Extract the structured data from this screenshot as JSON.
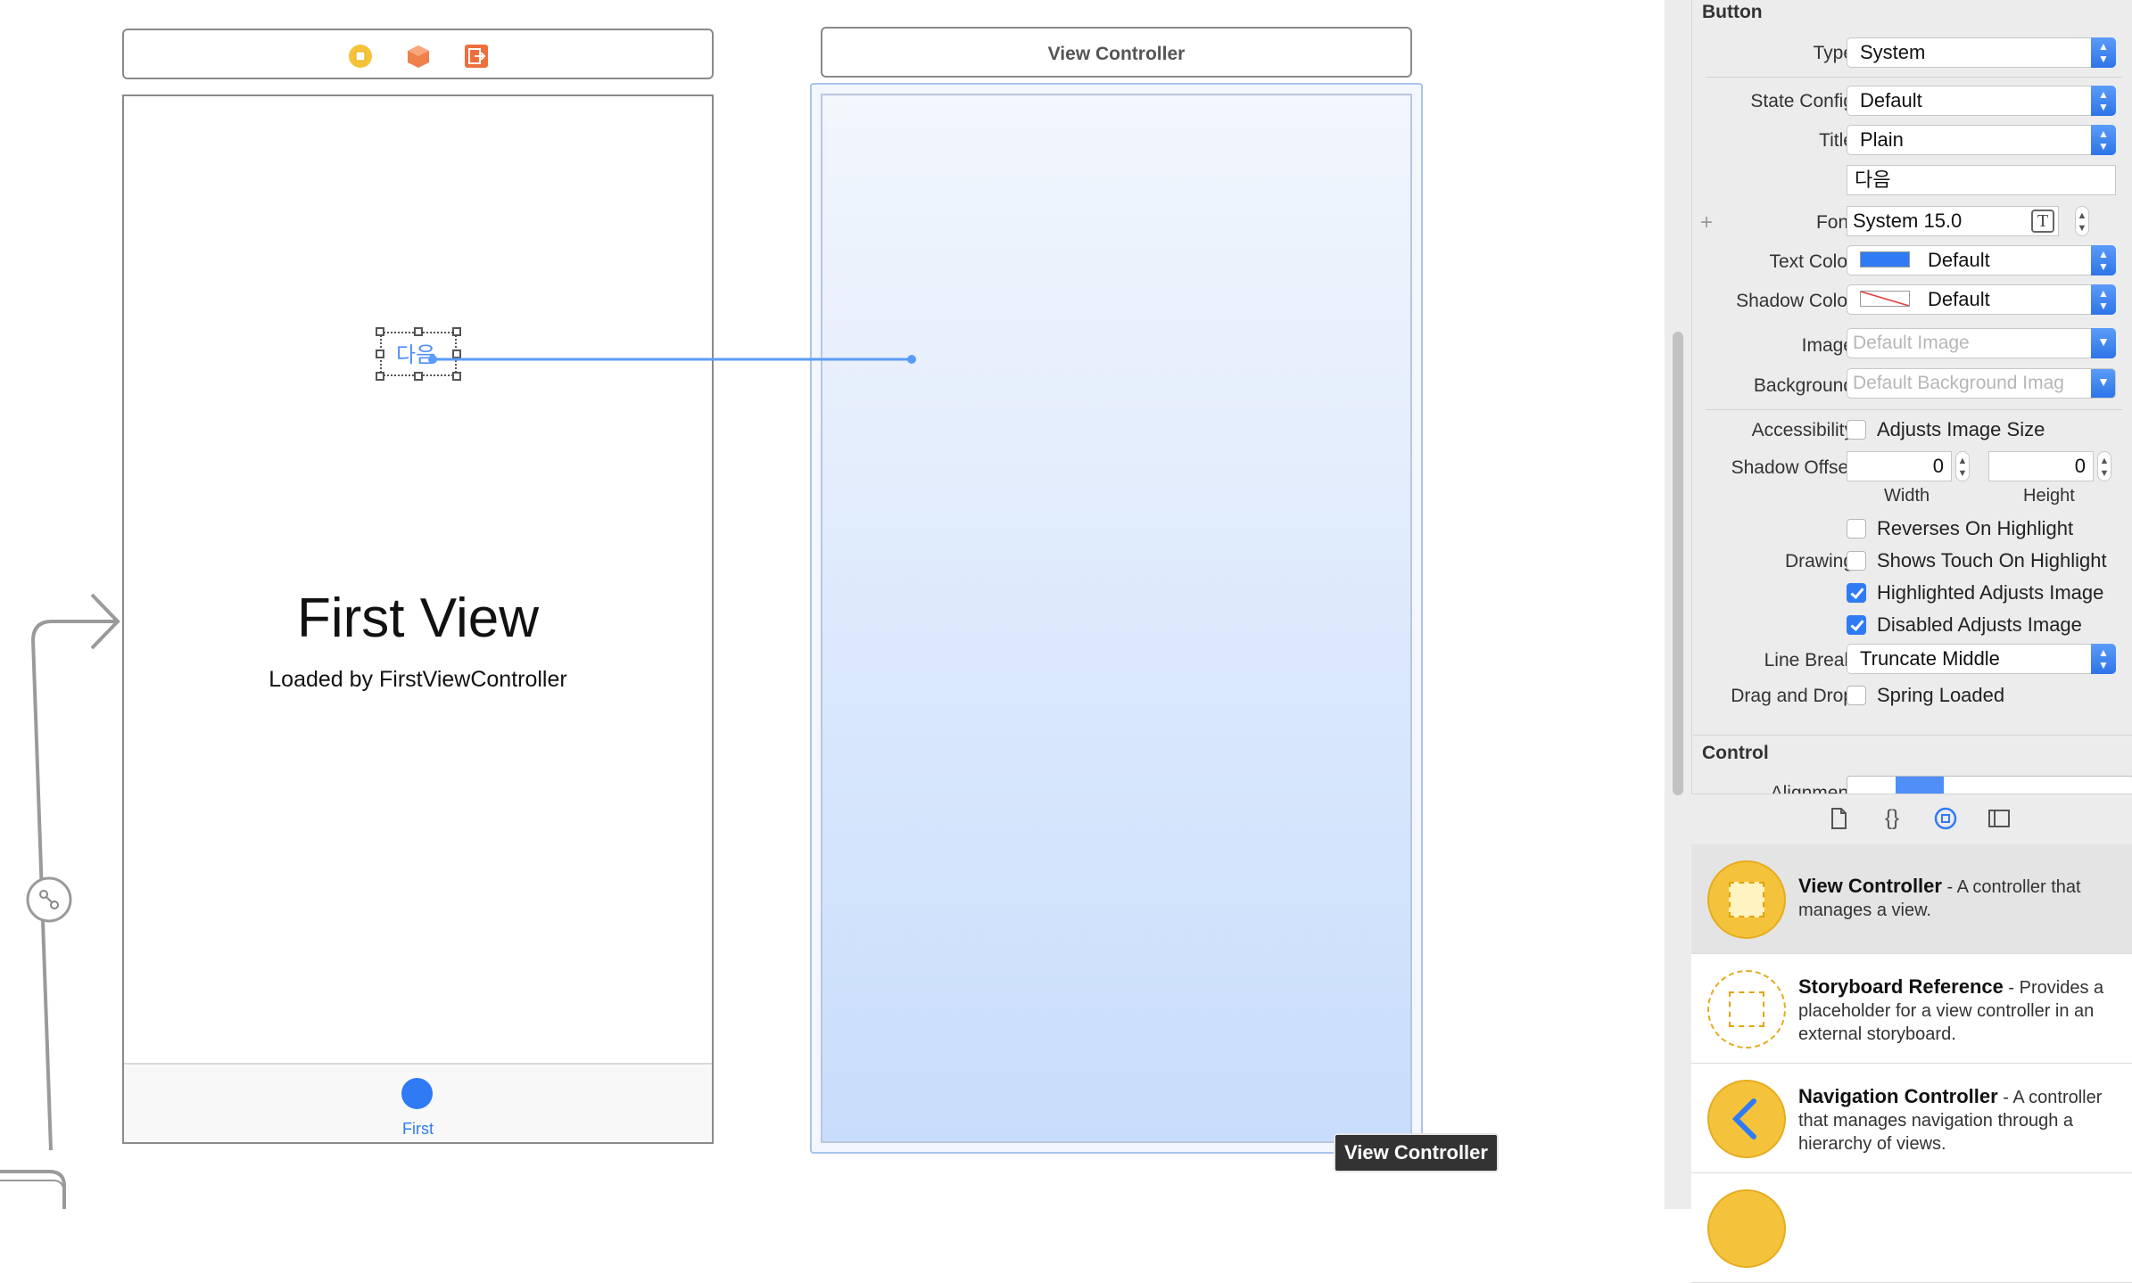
{
  "canvas": {
    "first_scene": {
      "title": "First View",
      "subtitle": "Loaded by FirstViewController",
      "button_text": "다음",
      "tab_label": "First"
    },
    "second_scene": {
      "dock_title": "View Controller",
      "tooltip": "View Controller"
    },
    "dock_icons": [
      "view-controller-icon",
      "first-responder-icon",
      "exit-icon"
    ]
  },
  "inspector": {
    "button_section": {
      "title": "Button",
      "type_label": "Type",
      "type_value": "System",
      "state_label": "State Config",
      "state_value": "Default",
      "title_label": "Title",
      "title_value": "Plain",
      "title_text": "다음",
      "font_label": "Font",
      "font_value": "System 15.0",
      "text_color_label": "Text Color",
      "text_color_value": "Default",
      "text_color_hex": "#2f7bf5",
      "shadow_color_label": "Shadow Color",
      "shadow_color_value": "Default",
      "image_label": "Image",
      "image_placeholder": "Default Image",
      "background_label": "Background",
      "background_placeholder": "Default Background Imag",
      "accessibility_label": "Accessibility",
      "adjusts_image_size": "Adjusts Image Size",
      "shadow_offset_label": "Shadow Offset",
      "shadow_width": "0",
      "shadow_height": "0",
      "width_label": "Width",
      "height_label": "Height",
      "reverses_on_highlight": "Reverses On Highlight",
      "drawing_label": "Drawing",
      "shows_touch_on_highlight": "Shows Touch On Highlight",
      "highlighted_adjusts_image": "Highlighted Adjusts Image",
      "disabled_adjusts_image": "Disabled Adjusts Image",
      "line_break_label": "Line Break",
      "line_break_value": "Truncate Middle",
      "drag_drop_label": "Drag and Drop",
      "spring_loaded": "Spring Loaded"
    },
    "control_section": {
      "title": "Control",
      "alignment_label": "Alignment"
    },
    "checkbox_states": {
      "adjusts_image_size": false,
      "reverses_on_highlight": false,
      "shows_touch_on_highlight": false,
      "highlighted_adjusts_image": true,
      "disabled_adjusts_image": true,
      "spring_loaded": false
    },
    "tabs": [
      "file-icon",
      "code-braces-icon",
      "object-library-icon",
      "media-library-icon"
    ]
  },
  "library": {
    "items": [
      {
        "name": "View Controller",
        "desc": " - A controller that manages a view."
      },
      {
        "name": "Storyboard Reference",
        "desc": " - Provides a placeholder for a view controller in an external storyboard."
      },
      {
        "name": "Navigation Controller",
        "desc": " - A controller that manages navigation through a hierarchy of views."
      }
    ]
  }
}
